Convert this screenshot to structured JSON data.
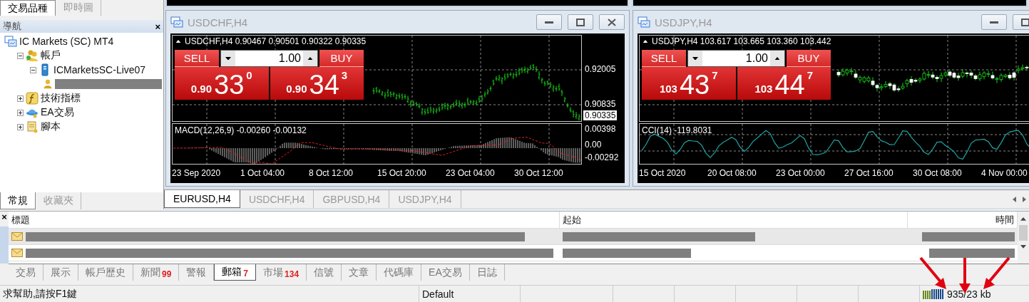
{
  "left_panel": {
    "tabs": [
      {
        "label": "交易品種",
        "selected": true
      },
      {
        "label": "即時圖",
        "selected": false
      }
    ],
    "navigator": {
      "title": "導航",
      "close": "×",
      "tree": [
        {
          "label": "IC Markets (SC) MT4",
          "kind": "terminal",
          "children": [
            {
              "label": "帳戶",
              "kind": "accounts",
              "expanded": true,
              "children": [
                {
                  "label": "ICMarketsSC-Live07",
                  "kind": "server",
                  "expanded": true,
                  "children": [
                    {
                      "kind": "account",
                      "redacted": true
                    }
                  ]
                }
              ]
            },
            {
              "label": "技術指標",
              "kind": "indicators",
              "expanded": false
            },
            {
              "label": "EA交易",
              "kind": "experts",
              "expanded": false
            },
            {
              "label": "腳本",
              "kind": "scripts",
              "expanded": false
            }
          ]
        }
      ]
    },
    "bottom_tabs": [
      {
        "label": "常規",
        "selected": true
      },
      {
        "label": "收藏夾",
        "selected": false
      }
    ]
  },
  "charts": [
    {
      "title": "USDCHF,H4",
      "kind": "bars",
      "symbol": "USDCHF,H4",
      "ohlc": "0.90467 0.90501 0.90322 0.90335",
      "trade": {
        "sell": "SELL",
        "buy": "BUY",
        "lot": "1.00",
        "bid": {
          "big": "0.90",
          "pips": "33",
          "point": "0"
        },
        "ask": {
          "big": "0.90",
          "pips": "34",
          "point": "3"
        }
      },
      "price_axis": [
        "0.92005",
        "0.90835"
      ],
      "current_price": "0.90335",
      "indicator": {
        "kind": "macd",
        "label": "MACD(12,26,9) -0.00260 -0.00132",
        "axis": [
          "0.00398",
          "0.00",
          "-0.00292"
        ]
      },
      "time_axis": [
        "23 Sep 2020",
        "1 Oct 04:00",
        "8 Oct 12:00",
        "15 Oct 20:00",
        "23 Oct 04:00",
        "30 Oct 12:00"
      ]
    },
    {
      "title": "USDJPY,H4",
      "kind": "candles",
      "symbol": "USDJPY,H4",
      "ohlc": "103.617 103.665 103.360 103.442",
      "trade": {
        "sell": "SELL",
        "buy": "BUY",
        "lot": "1.00",
        "bid": {
          "big": "103",
          "pips": "43",
          "point": "7"
        },
        "ask": {
          "big": "103",
          "pips": "44",
          "point": "7"
        }
      },
      "indicator": {
        "kind": "cci",
        "label": "CCI(14) -119.8031"
      },
      "time_axis": [
        "15 Oct 2020",
        "20 Oct 08:00",
        "23 Oct 00:00",
        "27 Oct 16:00",
        "30 Oct 08:00",
        "4 Nov 00:00"
      ]
    }
  ],
  "chart_tabs": [
    {
      "label": "EURUSD,H4",
      "selected": true
    },
    {
      "label": "USDCHF,H4",
      "selected": false
    },
    {
      "label": "GBPUSD,H4",
      "selected": false
    },
    {
      "label": "USDJPY,H4",
      "selected": false
    }
  ],
  "terminal": {
    "close": "×",
    "columns": [
      "標題",
      "起始",
      "時間"
    ],
    "rows": [
      {
        "selected": true,
        "redacted": true
      },
      {
        "selected": false,
        "redacted": true
      }
    ],
    "tabs": [
      {
        "label": "交易",
        "selected": false
      },
      {
        "label": "展示",
        "selected": false
      },
      {
        "label": "帳戶歷史",
        "selected": false
      },
      {
        "label": "新聞",
        "badge": "99",
        "selected": false
      },
      {
        "label": "警報",
        "selected": false
      },
      {
        "label": "郵箱",
        "badge": "7",
        "selected": true
      },
      {
        "label": "市場",
        "badge": "134",
        "selected": false
      },
      {
        "label": "信號",
        "selected": false
      },
      {
        "label": "文章",
        "selected": false
      },
      {
        "label": "代碼庫",
        "selected": false
      },
      {
        "label": "EA交易",
        "selected": false
      },
      {
        "label": "日誌",
        "selected": false
      }
    ]
  },
  "status_bar": {
    "help": "求幫助,請按F1鍵",
    "profile": "Default",
    "connection": "935/23 kb"
  }
}
